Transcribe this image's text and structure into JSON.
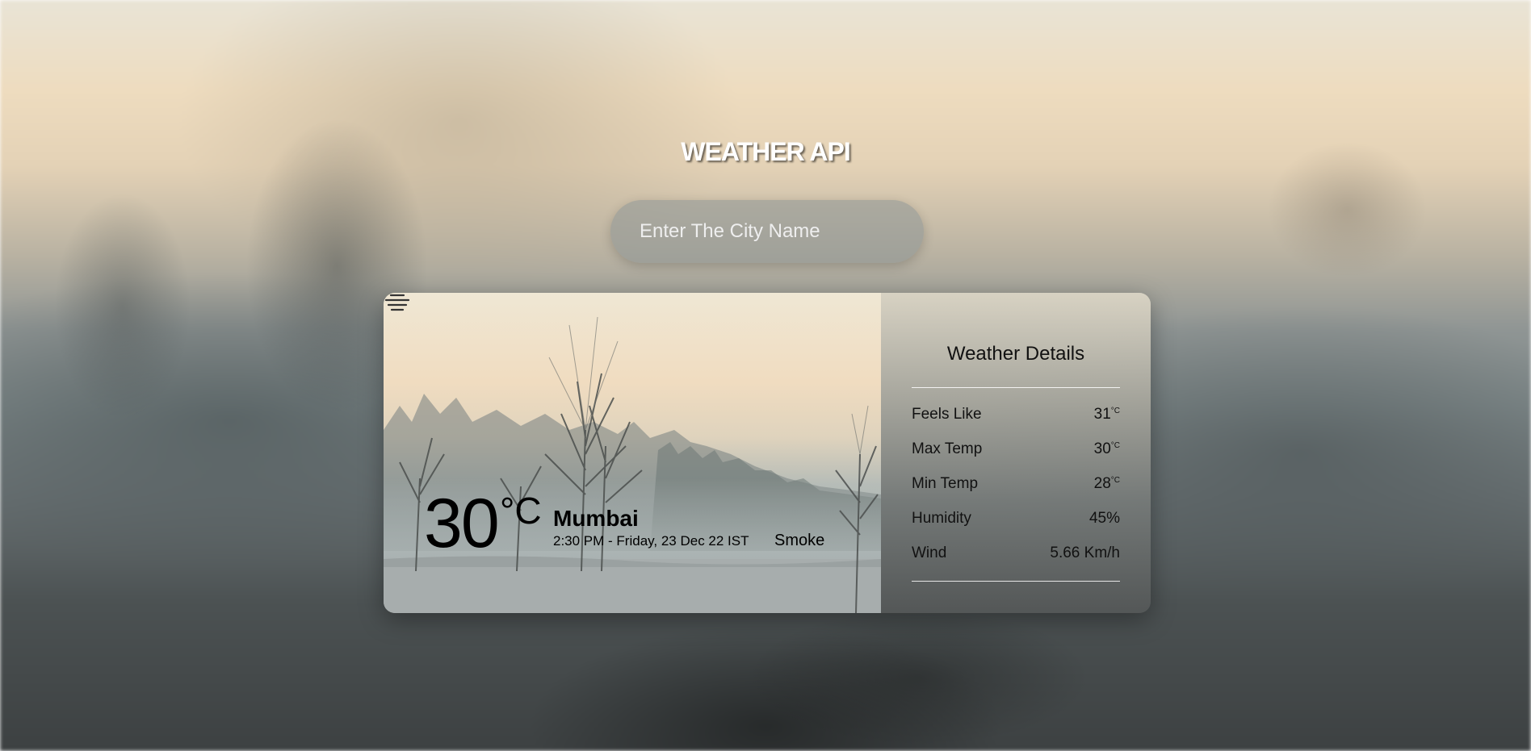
{
  "app": {
    "title": "WEATHER API"
  },
  "search": {
    "placeholder": "Enter The City Name",
    "value": ""
  },
  "current": {
    "temperature": "30",
    "unit": "°C",
    "city": "Mumbai",
    "datetime": "2:30 PM - Friday, 23 Dec 22 IST",
    "condition": "Smoke",
    "condition_icon": "haze-lines-icon"
  },
  "details": {
    "title": "Weather Details",
    "rows": [
      {
        "label": "Feels Like",
        "value": "31",
        "unit": "°C"
      },
      {
        "label": "Max Temp",
        "value": "30",
        "unit": "°C"
      },
      {
        "label": "Min Temp",
        "value": "28",
        "unit": "°C"
      },
      {
        "label": "Humidity",
        "value": "45%",
        "unit": ""
      },
      {
        "label": "Wind",
        "value": "5.66 Km/h",
        "unit": ""
      }
    ]
  },
  "colors": {
    "title_text": "#ffffff",
    "card_text": "#000000",
    "search_bg": "#8c9494"
  }
}
